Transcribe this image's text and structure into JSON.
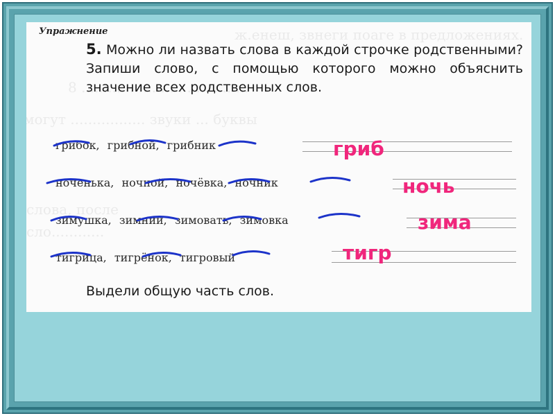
{
  "exercise": {
    "label": "Упражнение",
    "number": "5.",
    "question": "Можно ли назвать слова в каждой строчке родственными? Запиши слово, с помощью которого можно объяснить значение всех родственных слов.",
    "footer": "Выдели общую часть слов."
  },
  "rows": [
    {
      "words": [
        "грибок,",
        "грибной,",
        "грибник"
      ],
      "answer": "гриб"
    },
    {
      "words": [
        "ноченька,",
        "ночной,",
        "ночёвка,",
        "ночник"
      ],
      "answer": "ночь"
    },
    {
      "words": [
        "зимушка,",
        "зимний,",
        "зимовать,",
        "зимовка"
      ],
      "answer": "зима"
    },
    {
      "words": [
        "тигрица,",
        "тигрёнок,",
        "тигровый"
      ],
      "answer": "тигр"
    }
  ],
  "colors": {
    "frame": "#5aa3ad",
    "frame_inner": "#96d4db",
    "answer": "#f0267c",
    "root_mark": "#1c33c9"
  }
}
